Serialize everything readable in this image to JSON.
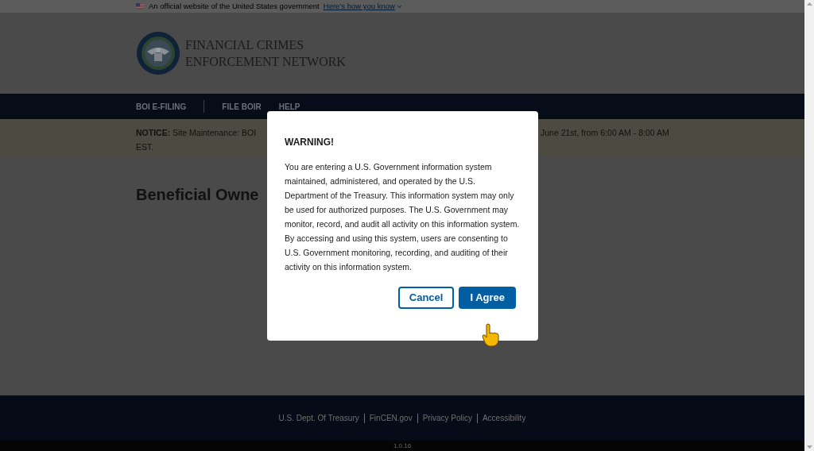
{
  "gov_banner": {
    "text": "An official website of the United States government",
    "link": "Here’s how you know"
  },
  "header": {
    "agency_name_lines": [
      "FINANCIAL CRIMES",
      "ENFORCEMENT NETWORK"
    ]
  },
  "nav": {
    "items": [
      {
        "label": "BOI E-FILING",
        "divider_after": true
      },
      {
        "label": "FILE BOIR",
        "divider_after": false
      },
      {
        "label": "HELP",
        "divider_after": false
      }
    ]
  },
  "notice": {
    "label": "NOTICE:",
    "text_start": "Site Maintenance: BOI",
    "text_end": "June 21st, from 6:00 AM - 8:00 AM",
    "text_wrap": "EST."
  },
  "page_title": "Beneficial Owne",
  "footer": {
    "links": [
      "U.S. Dept. Of Treasury",
      "FinCEN.gov",
      "Privacy Policy",
      "Accessibility"
    ],
    "version": "1.0.16"
  },
  "modal": {
    "title": "WARNING!",
    "body": "You are entering a U.S. Government information system maintained, administered, and operated by the U.S. Department of the Treasury. This information system may only be used for authorized purposes. The U.S. Government may monitor, record, and audit all activity on this information system. By accessing and using this system, users are consenting to U.S. Government monitoring, recording, and auditing of their activity on this information system.",
    "buttons": [
      {
        "label": "Cancel",
        "kind": "outline"
      },
      {
        "label": "I Agree",
        "kind": "primary"
      }
    ]
  }
}
